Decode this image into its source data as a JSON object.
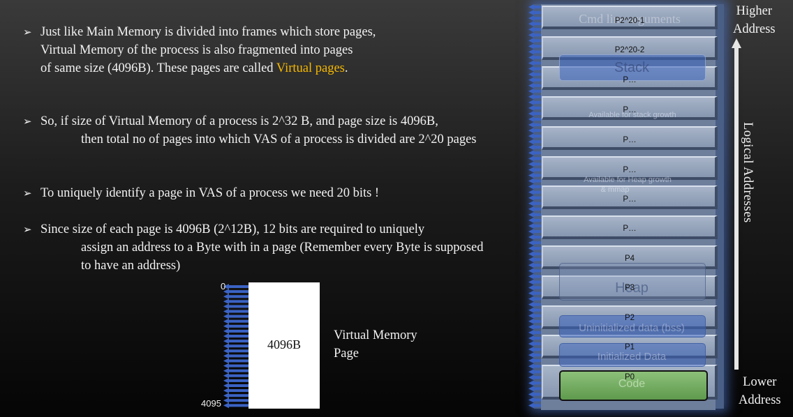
{
  "bullets": [
    {
      "lines": [
        "Just like Main Memory is divided into frames which store pages,",
        "Virtual Memory of the process is also fragmented into pages"
      ],
      "last_line_prefix": "of same size (4096B). These pages are called ",
      "highlight": "Virtual pages",
      "last_line_suffix": "."
    },
    {
      "lines": [
        "So, if size of Virtual Memory of a process is 2^32 B, and page size is 4096B,",
        "then total no of pages into which VAS of a process is divided are 2^20 pages"
      ]
    },
    {
      "lines": [
        "To uniquely identify a page in VAS of a process we need 20 bits !"
      ]
    },
    {
      "lines": [
        "Since size of each page is 4096B (2^12B), 12 bits are required to uniquely",
        "assign an address to a Byte with in a page (Remember every Byte is supposed",
        "to have an address)"
      ]
    }
  ],
  "page_diagram": {
    "size_label": "4096B",
    "start_offset": "0",
    "end_offset": "4095",
    "caption_line1": "Virtual Memory",
    "caption_line2": "Page"
  },
  "vas": {
    "top_label_line1": "Higher",
    "top_label_line2": "Address",
    "bottom_label_line1": "Lower",
    "bottom_label_line2": "Address",
    "axis_label": "Logical Addresses",
    "pages": [
      "P2^20-1",
      "P2^20-2",
      "P…",
      "P…",
      "P…",
      "P…",
      "P…",
      "P…",
      "P4",
      "P3",
      "P2",
      "P1",
      "P0"
    ],
    "segments": {
      "cmd": "Cmd line arguments",
      "stack": "Stack",
      "stack_growth": "Available for stack growth",
      "heap_growth_line1": "Available for Heap growth",
      "heap_growth_line2": "& mmap",
      "heap": "Heap",
      "bss": "Uninitialized data (bss)",
      "data": "Initialized Data",
      "code": "Code"
    },
    "colors": {
      "accent": "#f5b800",
      "arrow": "#3b63c4",
      "code": "#6fa35c"
    }
  }
}
